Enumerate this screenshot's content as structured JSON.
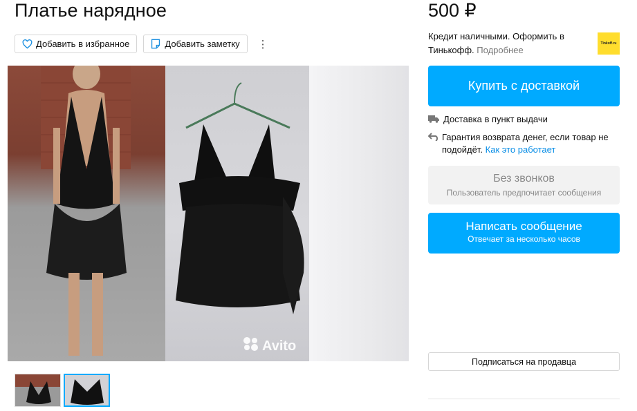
{
  "listing": {
    "title": "Платье нарядное"
  },
  "actions": {
    "favorite_label": "Добавить в избранное",
    "note_label": "Добавить заметку",
    "more_label": "⋮"
  },
  "gallery": {
    "watermark": "Avito"
  },
  "sidebar": {
    "price": "500 ₽",
    "credit_text": "Кредит наличными. Оформить в Тинькофф.",
    "credit_link": "Подробнее",
    "tinkoff_logo": "Tinkoff.ru",
    "buy_button": "Купить с доставкой",
    "delivery_text": "Доставка в пункт выдачи",
    "guarantee_text": "Гарантия возврата денег, если товар не подойдёт.",
    "guarantee_link": "Как это работает",
    "no_calls_title": "Без звонков",
    "no_calls_subtitle": "Пользователь предпочитает сообщения",
    "message_button": "Написать сообщение",
    "message_subtitle": "Отвечает за несколько часов",
    "subscribe_button": "Подписаться на продавца"
  },
  "colors": {
    "accent": "#00aaff",
    "tinkoff": "#ffdd2d",
    "link": "#0a8ee6"
  }
}
